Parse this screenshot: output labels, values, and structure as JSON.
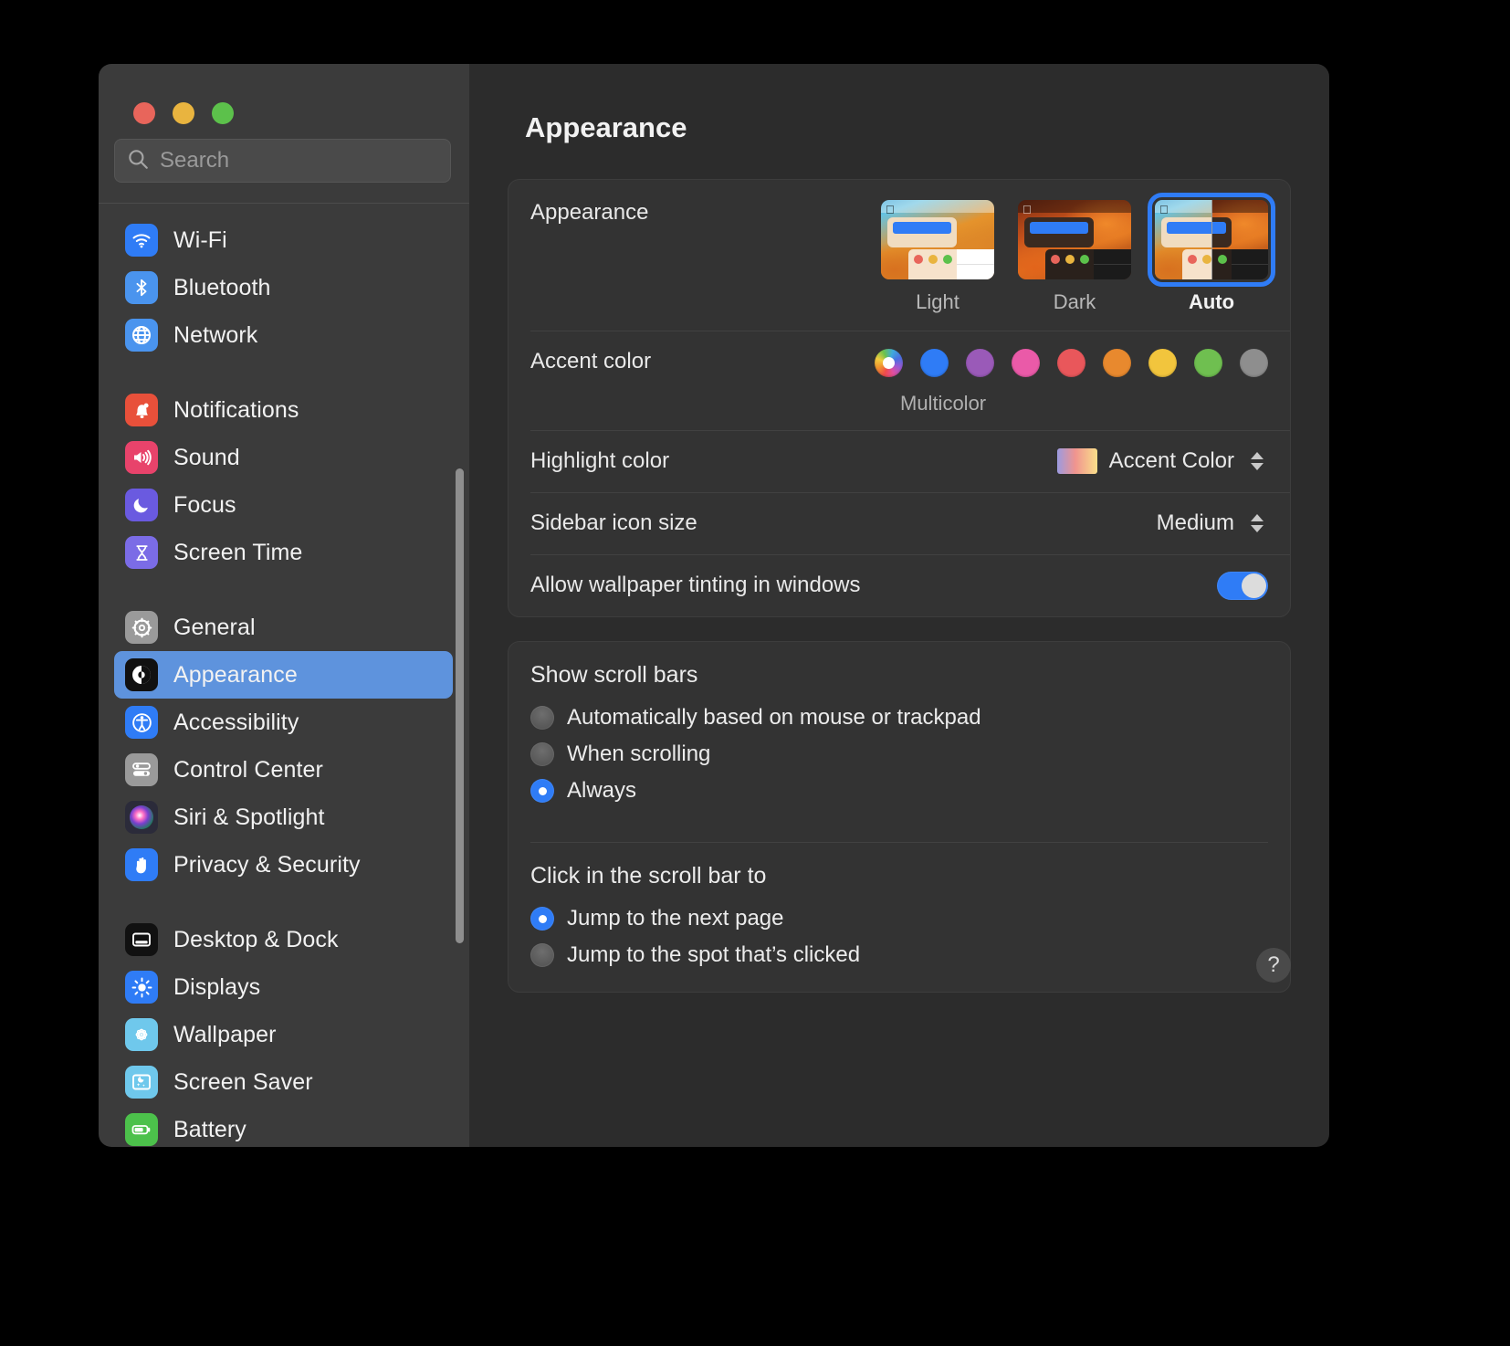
{
  "window": {
    "traffic_lights": [
      {
        "name": "close",
        "color": "#e8655b"
      },
      {
        "name": "minimize",
        "color": "#e9b43f"
      },
      {
        "name": "maximize",
        "color": "#5cc14b"
      }
    ]
  },
  "search": {
    "placeholder": "Search",
    "value": "",
    "icon": "search-icon"
  },
  "sidebar": {
    "groups": [
      {
        "items": [
          {
            "label": "Wi-Fi",
            "icon": "wifi-icon",
            "icon_bg": "#2f7cf6",
            "selected": false
          },
          {
            "label": "Bluetooth",
            "icon": "bluetooth-icon",
            "icon_bg": "#4a94ee",
            "selected": false
          },
          {
            "label": "Network",
            "icon": "globe-icon",
            "icon_bg": "#4a94ee",
            "selected": false
          }
        ]
      },
      {
        "items": [
          {
            "label": "Notifications",
            "icon": "bell-icon",
            "icon_bg": "#e8503a",
            "selected": false
          },
          {
            "label": "Sound",
            "icon": "speaker-icon",
            "icon_bg": "#e8436b",
            "selected": false
          },
          {
            "label": "Focus",
            "icon": "moon-icon",
            "icon_bg": "#6a5ae0",
            "selected": false
          },
          {
            "label": "Screen Time",
            "icon": "hourglass-icon",
            "icon_bg": "#7b6ce6",
            "selected": false
          }
        ]
      },
      {
        "items": [
          {
            "label": "General",
            "icon": "gear-icon",
            "icon_bg": "#9a9a9a",
            "selected": false
          },
          {
            "label": "Appearance",
            "icon": "appearance-icon",
            "icon_bg": "#111111",
            "selected": true
          },
          {
            "label": "Accessibility",
            "icon": "accessibility-icon",
            "icon_bg": "#2f7cf6",
            "selected": false
          },
          {
            "label": "Control Center",
            "icon": "control-center-icon",
            "icon_bg": "#9a9a9a",
            "selected": false
          },
          {
            "label": "Siri & Spotlight",
            "icon": "siri-icon",
            "icon_bg": "#2b2b3a",
            "selected": false
          },
          {
            "label": "Privacy & Security",
            "icon": "hand-icon",
            "icon_bg": "#2f7cf6",
            "selected": false
          }
        ]
      },
      {
        "items": [
          {
            "label": "Desktop & Dock",
            "icon": "desktop-dock-icon",
            "icon_bg": "#111111",
            "selected": false
          },
          {
            "label": "Displays",
            "icon": "brightness-icon",
            "icon_bg": "#2f7cf6",
            "selected": false
          },
          {
            "label": "Wallpaper",
            "icon": "wallpaper-icon",
            "icon_bg": "#6fc8ec",
            "selected": false
          },
          {
            "label": "Screen Saver",
            "icon": "screen-saver-icon",
            "icon_bg": "#6fc8ec",
            "selected": false
          },
          {
            "label": "Battery",
            "icon": "battery-icon",
            "icon_bg": "#4cc14b",
            "selected": false
          }
        ]
      }
    ]
  },
  "main": {
    "title": "Appearance",
    "appearance": {
      "label": "Appearance",
      "options": [
        {
          "name": "Light",
          "selected": false
        },
        {
          "name": "Dark",
          "selected": false
        },
        {
          "name": "Auto",
          "selected": true
        }
      ]
    },
    "accent": {
      "label": "Accent color",
      "caption": "Multicolor",
      "swatches": [
        {
          "name": "multicolor",
          "color": "multicolor",
          "selected": true
        },
        {
          "name": "blue",
          "color": "#2f7cf6"
        },
        {
          "name": "purple",
          "color": "#9a5ab8"
        },
        {
          "name": "pink",
          "color": "#ea5aa8"
        },
        {
          "name": "red",
          "color": "#e9575b"
        },
        {
          "name": "orange",
          "color": "#e8892e"
        },
        {
          "name": "yellow",
          "color": "#f2c53d"
        },
        {
          "name": "green",
          "color": "#6fbf50"
        },
        {
          "name": "graphite",
          "color": "#8e8e8e"
        }
      ]
    },
    "highlight": {
      "label": "Highlight color",
      "value": "Accent Color"
    },
    "sidebar_icon_size": {
      "label": "Sidebar icon size",
      "value": "Medium"
    },
    "wallpaper_tinting": {
      "label": "Allow wallpaper tinting in windows",
      "enabled": true
    },
    "scroll_bars": {
      "title": "Show scroll bars",
      "options": [
        {
          "label": "Automatically based on mouse or trackpad",
          "selected": false
        },
        {
          "label": "When scrolling",
          "selected": false
        },
        {
          "label": "Always",
          "selected": true
        }
      ]
    },
    "click_scroll_bar": {
      "title": "Click in the scroll bar to",
      "options": [
        {
          "label": "Jump to the next page",
          "selected": true
        },
        {
          "label": "Jump to the spot that’s clicked",
          "selected": false
        }
      ]
    },
    "help": {
      "label": "?"
    }
  }
}
